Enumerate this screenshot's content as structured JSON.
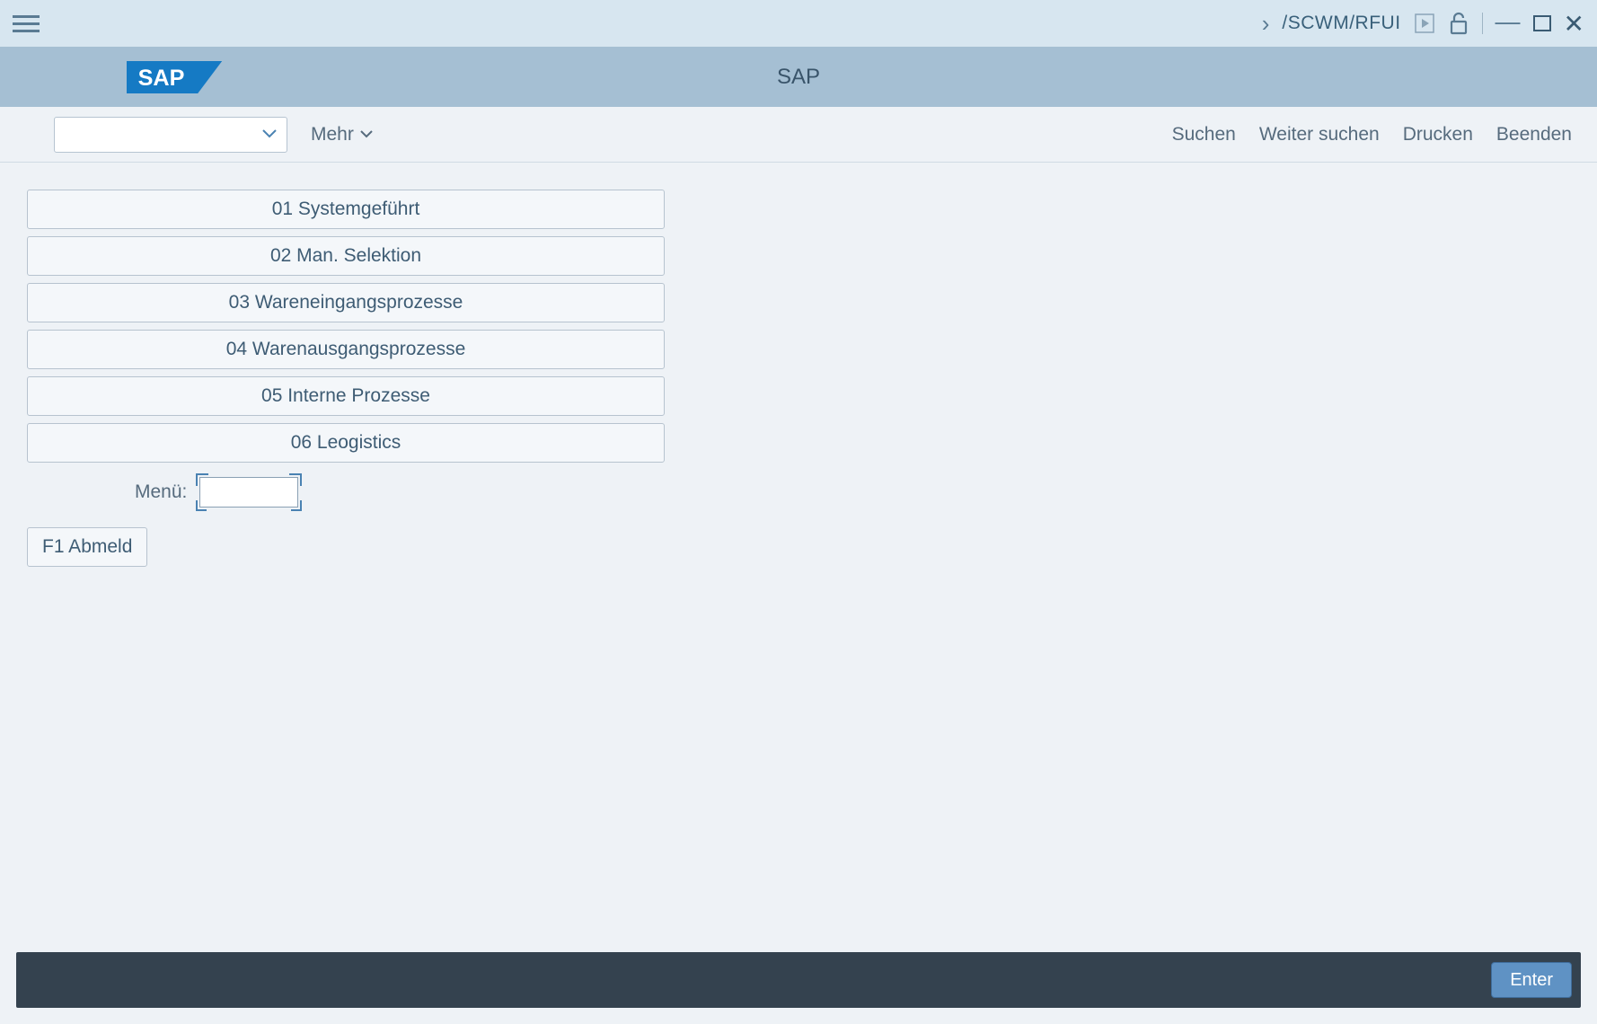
{
  "sysbar": {
    "tcode": "/SCWM/RFUI"
  },
  "header": {
    "title": "SAP"
  },
  "toolbar": {
    "mehr": "Mehr",
    "links": {
      "suchen": "Suchen",
      "weiter_suchen": "Weiter suchen",
      "drucken": "Drucken",
      "beenden": "Beenden"
    }
  },
  "menu": {
    "items": [
      "01 Systemgeführt",
      "02 Man. Selektion",
      "03 Wareneingangsprozesse",
      "04 Warenausgangsprozesse",
      "05 Interne Prozesse",
      "06 Leogistics"
    ],
    "input_label": "Menü:",
    "input_value": ""
  },
  "buttons": {
    "f1": "F1 Abmeld",
    "enter": "Enter"
  }
}
